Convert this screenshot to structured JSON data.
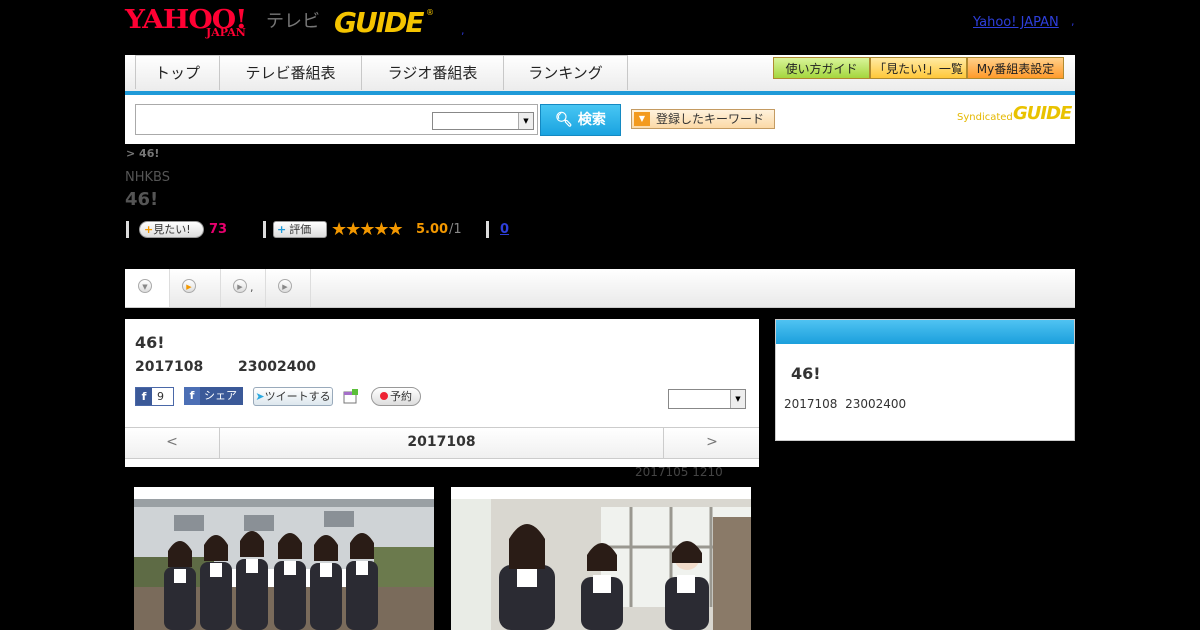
{
  "header": {
    "logo_main": "YAHOO!",
    "logo_sub": "JAPAN",
    "logo_tv": "テレビ",
    "logo_gguide": "GUIDE",
    "yahoo_japan_link": "Yahoo! JAPAN",
    "dot_a": ",",
    "dot_b": ","
  },
  "nav": {
    "tabs": [
      "トップ",
      "テレビ番組表",
      "ラジオ番組表",
      "ランキング"
    ],
    "buttons": [
      {
        "label": "使い方ガイド",
        "color": "#b6e25a"
      },
      {
        "label": "「見たい!」一覧",
        "color": "#ffd35a"
      },
      {
        "label": "My番組表設定",
        "color": "#ffaa3a"
      }
    ]
  },
  "search": {
    "input_value": "",
    "select_value": "",
    "button_label": "検索",
    "keyword_button": "登録したキーワード",
    "syndicated": "Syndicated",
    "syndicated_logo": "GUIDE"
  },
  "program": {
    "breadcrumb": "> 46!",
    "channel": "NHKBS",
    "title": "46!",
    "mitai_label": "見たい!",
    "mitai_count": "73",
    "rate_label": "評価",
    "stars": "★★★★★",
    "score": "5.00",
    "score_den": "/1",
    "reviews_count": "0"
  },
  "tabs_bar": {
    "tab2_text": ","
  },
  "main_panel": {
    "title": "46!",
    "date": "2017108",
    "time": "23002400",
    "fb_like_count": "9",
    "fb_share": "シェア",
    "tweet": "ツイートする",
    "reserve": "予約",
    "select_value": "",
    "prev": "<",
    "current_date": "2017108",
    "next": ">"
  },
  "side_panel": {
    "title": "46!",
    "date": "2017108",
    "time": "23002400"
  },
  "updated": "2017105  1210",
  "colors": {
    "accent_blue": "#1f9ad8",
    "mitai_pink": "#e6006e",
    "star_orange": "#f39800",
    "link_blue": "#2e3fdb"
  }
}
